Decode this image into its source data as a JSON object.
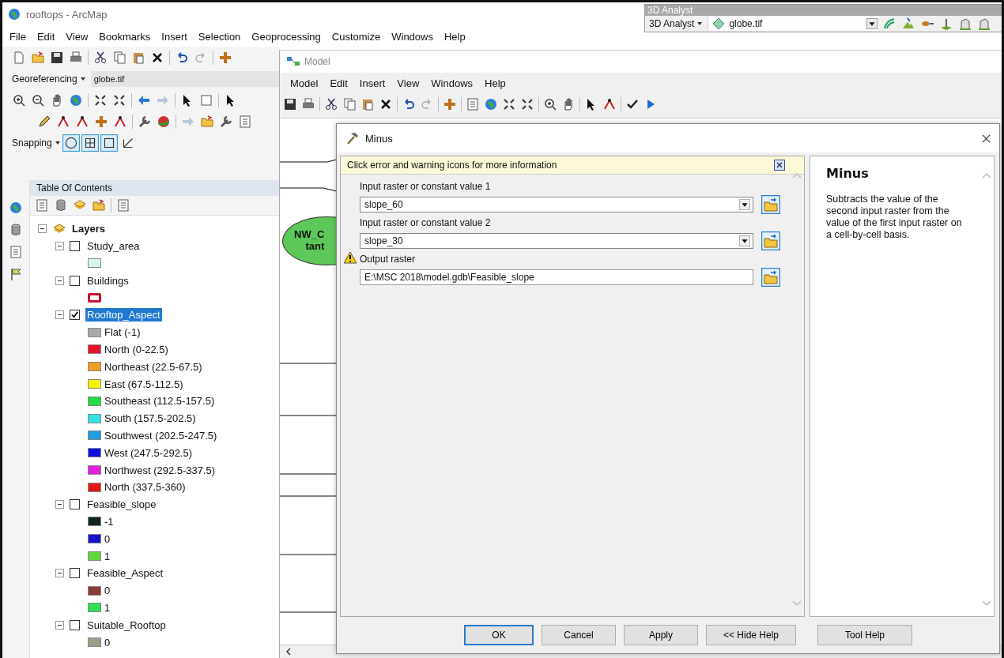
{
  "window": {
    "title": "rooftops - ArcMap"
  },
  "menu": [
    "File",
    "Edit",
    "View",
    "Bookmarks",
    "Insert",
    "Selection",
    "Geoprocessing",
    "Customize",
    "Windows",
    "Help"
  ],
  "georeferencing": {
    "label": "Georeferencing",
    "layer": "globe.tif"
  },
  "snapping": {
    "label": "Snapping"
  },
  "analyst_toolbar": {
    "title": "3D Analyst",
    "menu": "3D Analyst",
    "layer": "globe.tif"
  },
  "toc": {
    "title": "Table Of Contents",
    "root": {
      "label": "Layers",
      "expanded": true,
      "children": [
        {
          "name": "Study_area",
          "checked": false,
          "expanded": true,
          "selected": false,
          "legend": [
            {
              "kind": "fill",
              "color": "#d4f5e6"
            }
          ]
        },
        {
          "name": "Buildings",
          "checked": false,
          "expanded": true,
          "selected": false,
          "legend": [
            {
              "kind": "outline",
              "color": "#c8102e"
            }
          ]
        },
        {
          "name": "Rooftop_Aspect",
          "checked": true,
          "expanded": true,
          "selected": true,
          "legend": [
            {
              "kind": "fill",
              "label": "Flat (-1)",
              "color": "#a9a9a9"
            },
            {
              "kind": "fill",
              "label": "North (0-22.5)",
              "color": "#e8102a"
            },
            {
              "kind": "fill",
              "label": "Northeast (22.5-67.5)",
              "color": "#f39c1e"
            },
            {
              "kind": "fill",
              "label": "East (67.5-112.5)",
              "color": "#f5f500"
            },
            {
              "kind": "fill",
              "label": "Southeast (112.5-157.5)",
              "color": "#22dd44"
            },
            {
              "kind": "fill",
              "label": "South (157.5-202.5)",
              "color": "#33e3e3"
            },
            {
              "kind": "fill",
              "label": "Southwest (202.5-247.5)",
              "color": "#1e9fe0"
            },
            {
              "kind": "fill",
              "label": "West (247.5-292.5)",
              "color": "#1010dd"
            },
            {
              "kind": "fill",
              "label": "Northwest (292.5-337.5)",
              "color": "#e020d8"
            },
            {
              "kind": "fill",
              "label": "North (337.5-360)",
              "color": "#e01818"
            }
          ]
        },
        {
          "name": "Feasible_slope",
          "checked": false,
          "expanded": true,
          "selected": false,
          "legend": [
            {
              "kind": "fill",
              "label": "-1",
              "color": "#102418"
            },
            {
              "kind": "fill",
              "label": "0",
              "color": "#1414cc"
            },
            {
              "kind": "fill",
              "label": "1",
              "color": "#5fd640"
            }
          ]
        },
        {
          "name": "Feasible_Aspect",
          "checked": false,
          "expanded": true,
          "selected": false,
          "legend": [
            {
              "kind": "fill",
              "label": "0",
              "color": "#8a3c34"
            },
            {
              "kind": "fill",
              "label": "1",
              "color": "#2fe050"
            }
          ]
        },
        {
          "name": "Suitable_Rooftop",
          "checked": false,
          "expanded": true,
          "selected": false,
          "legend": [
            {
              "kind": "fill",
              "label": "0",
              "color": "#98a088"
            }
          ]
        }
      ]
    }
  },
  "model_window": {
    "title": "Model",
    "menu": [
      "Model",
      "Edit",
      "Insert",
      "View",
      "Windows",
      "Help"
    ],
    "node_lines": [
      "NW_C",
      "tant"
    ]
  },
  "dialog": {
    "title": "Minus",
    "message": "Click error and warning icons for more information",
    "params": [
      {
        "kind": "dropdown",
        "label": "Input raster or constant value 1",
        "value": "slope_60",
        "warning": false
      },
      {
        "kind": "dropdown",
        "label": "Input raster or constant value 2",
        "value": "slope_30",
        "warning": false
      },
      {
        "kind": "text",
        "label": "Output raster",
        "value": "E:\\MSC 2018\\model.gdb\\Feasible_slope",
        "warning": true
      }
    ],
    "help": {
      "title": "Minus",
      "text": "Subtracts the value of the second input raster from the value of the first input raster on a cell-by-cell basis."
    },
    "buttons": [
      {
        "label": "OK",
        "default": true
      },
      {
        "label": "Cancel",
        "default": false
      },
      {
        "label": "Apply",
        "default": false
      },
      {
        "label": "<< Hide Help",
        "default": false
      },
      {
        "label": "Tool Help",
        "default": false
      }
    ]
  }
}
